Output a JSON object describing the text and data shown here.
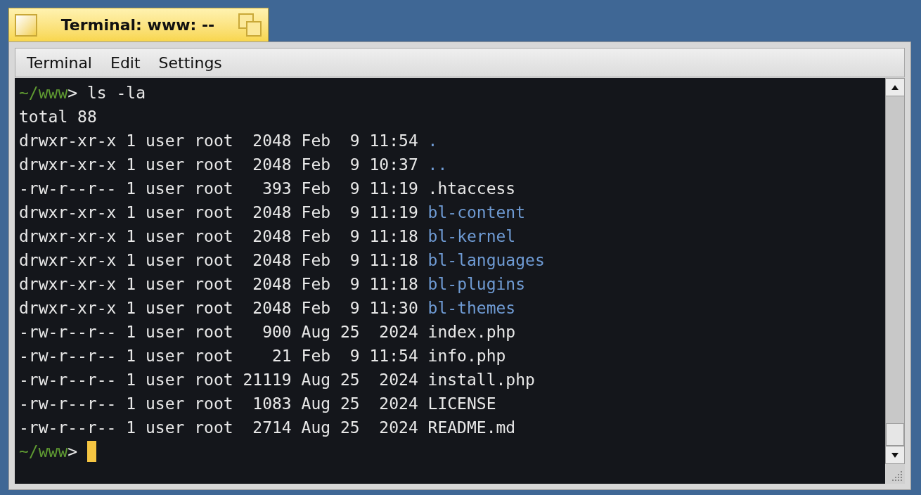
{
  "window": {
    "title": "Terminal: www: --"
  },
  "menu": [
    "Terminal",
    "Edit",
    "Settings"
  ],
  "terminal": {
    "lines": [
      {
        "segments": [
          {
            "kind": "prompt",
            "text": "~/www"
          },
          {
            "kind": "plain",
            "text": "> ls -la"
          }
        ],
        "cursor": false
      },
      {
        "segments": [
          {
            "kind": "plain",
            "text": "total 88"
          }
        ],
        "cursor": false
      },
      {
        "segments": [
          {
            "kind": "plain",
            "text": "drwxr-xr-x 1 user root  2048 Feb  9 11:54 "
          },
          {
            "kind": "dir",
            "text": "."
          }
        ],
        "cursor": false
      },
      {
        "segments": [
          {
            "kind": "plain",
            "text": "drwxr-xr-x 1 user root  2048 Feb  9 10:37 "
          },
          {
            "kind": "dir",
            "text": ".."
          }
        ],
        "cursor": false
      },
      {
        "segments": [
          {
            "kind": "plain",
            "text": "-rw-r--r-- 1 user root   393 Feb  9 11:19 .htaccess"
          }
        ],
        "cursor": false
      },
      {
        "segments": [
          {
            "kind": "plain",
            "text": "drwxr-xr-x 1 user root  2048 Feb  9 11:19 "
          },
          {
            "kind": "dir",
            "text": "bl-content"
          }
        ],
        "cursor": false
      },
      {
        "segments": [
          {
            "kind": "plain",
            "text": "drwxr-xr-x 1 user root  2048 Feb  9 11:18 "
          },
          {
            "kind": "dir",
            "text": "bl-kernel"
          }
        ],
        "cursor": false
      },
      {
        "segments": [
          {
            "kind": "plain",
            "text": "drwxr-xr-x 1 user root  2048 Feb  9 11:18 "
          },
          {
            "kind": "dir",
            "text": "bl-languages"
          }
        ],
        "cursor": false
      },
      {
        "segments": [
          {
            "kind": "plain",
            "text": "drwxr-xr-x 1 user root  2048 Feb  9 11:18 "
          },
          {
            "kind": "dir",
            "text": "bl-plugins"
          }
        ],
        "cursor": false
      },
      {
        "segments": [
          {
            "kind": "plain",
            "text": "drwxr-xr-x 1 user root  2048 Feb  9 11:30 "
          },
          {
            "kind": "dir",
            "text": "bl-themes"
          }
        ],
        "cursor": false
      },
      {
        "segments": [
          {
            "kind": "plain",
            "text": "-rw-r--r-- 1 user root   900 Aug 25  2024 index.php"
          }
        ],
        "cursor": false
      },
      {
        "segments": [
          {
            "kind": "plain",
            "text": "-rw-r--r-- 1 user root    21 Feb  9 11:54 info.php"
          }
        ],
        "cursor": false
      },
      {
        "segments": [
          {
            "kind": "plain",
            "text": "-rw-r--r-- 1 user root 21119 Aug 25  2024 install.php"
          }
        ],
        "cursor": false
      },
      {
        "segments": [
          {
            "kind": "plain",
            "text": "-rw-r--r-- 1 user root  1083 Aug 25  2024 LICENSE"
          }
        ],
        "cursor": false
      },
      {
        "segments": [
          {
            "kind": "plain",
            "text": "-rw-r--r-- 1 user root  2714 Aug 25  2024 README.md"
          }
        ],
        "cursor": false
      },
      {
        "segments": [
          {
            "kind": "prompt",
            "text": "~/www"
          },
          {
            "kind": "plain",
            "text": "> "
          }
        ],
        "cursor": true
      }
    ]
  }
}
